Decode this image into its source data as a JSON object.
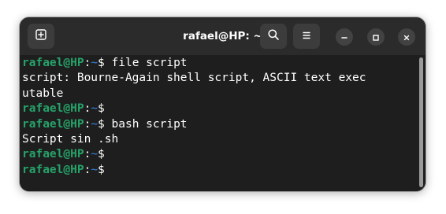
{
  "window": {
    "title": "rafael@HP: ~"
  },
  "icons": {
    "new_tab": "new-tab-icon",
    "search": "search-icon",
    "menu": "hamburger-menu-icon",
    "minimize": "minimize-icon",
    "maximize": "maximize-icon",
    "close": "close-icon"
  },
  "terminal": {
    "prompt": {
      "user": "rafael@HP",
      "sep": ":",
      "path": "~",
      "symbol": "$"
    },
    "lines": [
      {
        "kind": "prompt",
        "command": " file script"
      },
      {
        "kind": "output",
        "text": "script: Bourne-Again shell script, ASCII text exec"
      },
      {
        "kind": "output",
        "text": "utable"
      },
      {
        "kind": "prompt",
        "command": ""
      },
      {
        "kind": "prompt",
        "command": " bash script"
      },
      {
        "kind": "output",
        "text": "Script sin .sh"
      },
      {
        "kind": "prompt",
        "command": ""
      },
      {
        "kind": "prompt",
        "command": ""
      }
    ]
  },
  "colors": {
    "prompt_user": "#26a269",
    "prompt_path": "#3584e4",
    "terminal_bg": "#1e1e1e",
    "titlebar_bg": "#2b2b2b"
  }
}
